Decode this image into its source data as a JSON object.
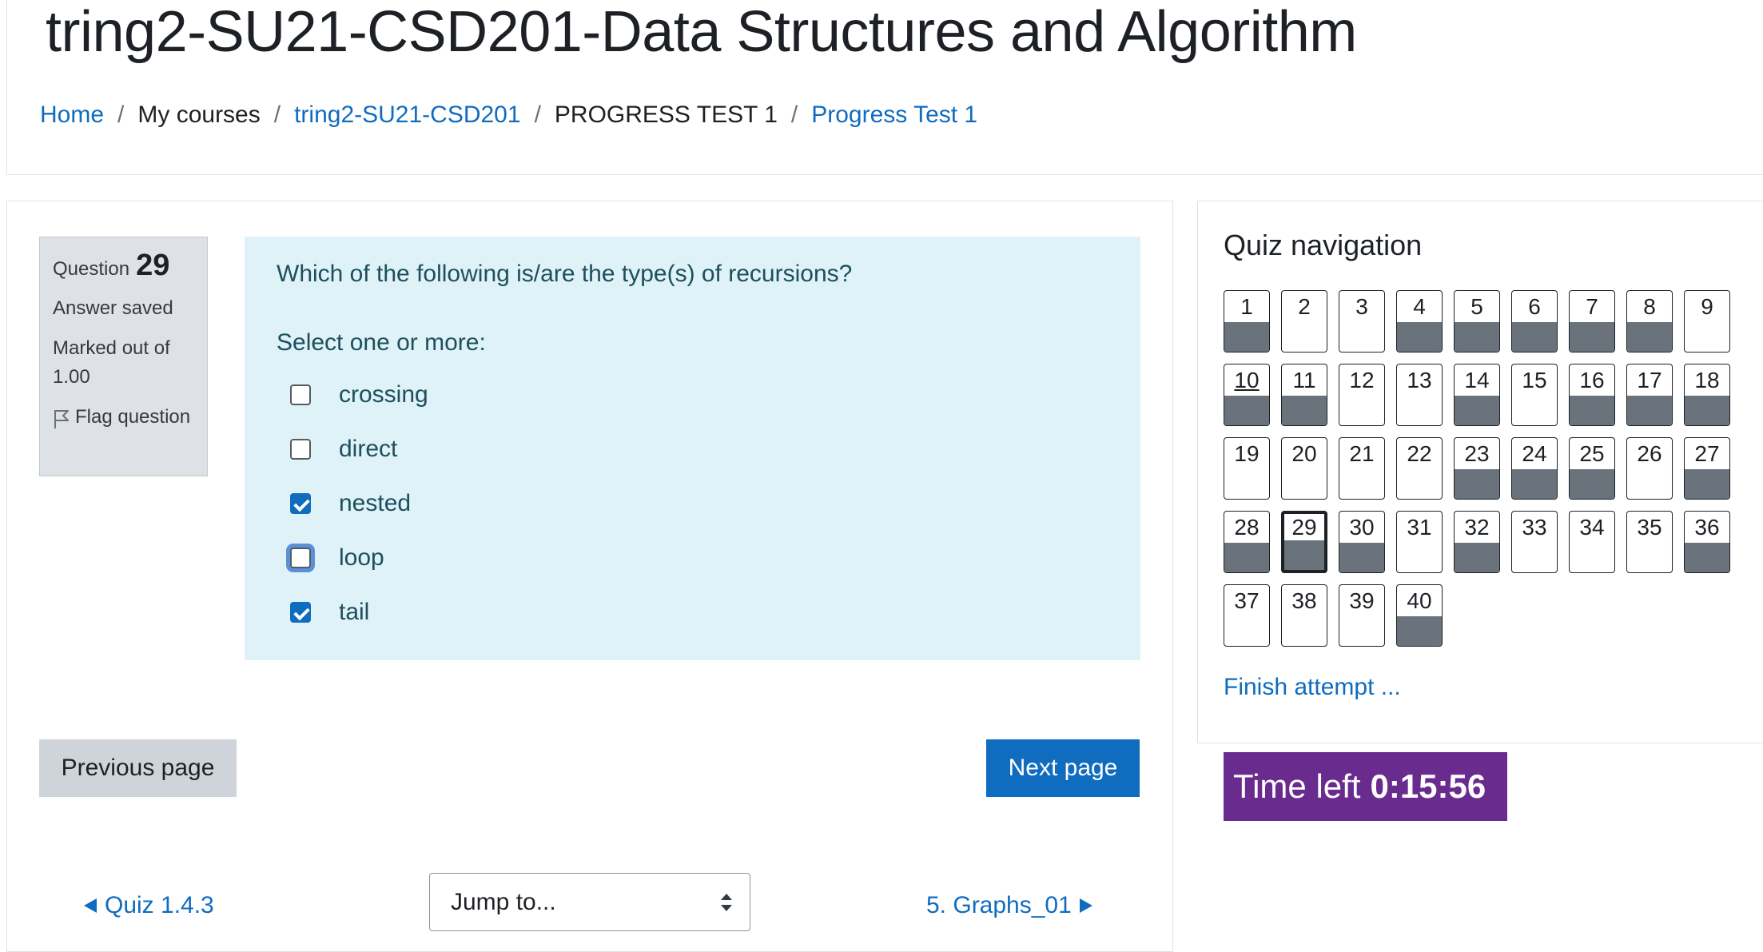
{
  "page_title": "tring2-SU21-CSD201-Data Structures and Algorithm",
  "breadcrumb": [
    {
      "label": "Home",
      "link": true
    },
    {
      "label": "My courses",
      "link": false
    },
    {
      "label": "tring2-SU21-CSD201",
      "link": true
    },
    {
      "label": "PROGRESS TEST 1",
      "link": false
    },
    {
      "label": "Progress Test 1",
      "link": true
    }
  ],
  "question_info": {
    "label": "Question",
    "number": "29",
    "state": "Answer saved",
    "grade": "Marked out of 1.00",
    "flag_label": "Flag question"
  },
  "question": {
    "text": "Which of the following is/are the type(s) of recursions?",
    "prompt": "Select one or more:",
    "options": [
      {
        "label": "crossing",
        "checked": false,
        "focused": false
      },
      {
        "label": "direct",
        "checked": false,
        "focused": false
      },
      {
        "label": "nested",
        "checked": true,
        "focused": false
      },
      {
        "label": "loop",
        "checked": false,
        "focused": true
      },
      {
        "label": "tail",
        "checked": true,
        "focused": false
      }
    ]
  },
  "buttons": {
    "previous": "Previous page",
    "next": "Next page"
  },
  "activity_nav": {
    "prev_label": "Quiz 1.4.3",
    "jump_label": "Jump to...",
    "next_label": "5. Graphs_01"
  },
  "quiz_nav": {
    "title": "Quiz navigation",
    "finish_label": "Finish attempt ...",
    "current": 29,
    "underlined": 10,
    "questions": [
      {
        "n": "1",
        "answered": true
      },
      {
        "n": "2",
        "answered": false
      },
      {
        "n": "3",
        "answered": false
      },
      {
        "n": "4",
        "answered": true
      },
      {
        "n": "5",
        "answered": true
      },
      {
        "n": "6",
        "answered": true
      },
      {
        "n": "7",
        "answered": true
      },
      {
        "n": "8",
        "answered": true
      },
      {
        "n": "9",
        "answered": false
      },
      {
        "n": "10",
        "answered": true
      },
      {
        "n": "11",
        "answered": true
      },
      {
        "n": "12",
        "answered": false
      },
      {
        "n": "13",
        "answered": false
      },
      {
        "n": "14",
        "answered": true
      },
      {
        "n": "15",
        "answered": false
      },
      {
        "n": "16",
        "answered": true
      },
      {
        "n": "17",
        "answered": true
      },
      {
        "n": "18",
        "answered": true
      },
      {
        "n": "19",
        "answered": false
      },
      {
        "n": "20",
        "answered": false
      },
      {
        "n": "21",
        "answered": false
      },
      {
        "n": "22",
        "answered": false
      },
      {
        "n": "23",
        "answered": true
      },
      {
        "n": "24",
        "answered": true
      },
      {
        "n": "25",
        "answered": true
      },
      {
        "n": "26",
        "answered": false
      },
      {
        "n": "27",
        "answered": true
      },
      {
        "n": "28",
        "answered": true
      },
      {
        "n": "29",
        "answered": true
      },
      {
        "n": "30",
        "answered": true
      },
      {
        "n": "31",
        "answered": false
      },
      {
        "n": "32",
        "answered": true
      },
      {
        "n": "33",
        "answered": false
      },
      {
        "n": "34",
        "answered": false
      },
      {
        "n": "35",
        "answered": false
      },
      {
        "n": "36",
        "answered": true
      },
      {
        "n": "37",
        "answered": false
      },
      {
        "n": "38",
        "answered": false
      },
      {
        "n": "39",
        "answered": false
      },
      {
        "n": "40",
        "answered": true
      }
    ]
  },
  "timer": {
    "label": "Time left",
    "value": "0:15:56"
  },
  "colors": {
    "link": "#0f6cbf",
    "question_bg": "#def2f8",
    "answered_fill": "#6a737b",
    "timer_bg": "#6a2b8e",
    "next_button": "#0f6cbf"
  },
  "icons": {
    "flag": "flag-outline-icon",
    "nav_prev": "triangle-left-icon",
    "nav_next": "triangle-right-icon",
    "select_arrows": "up-down-arrows-icon"
  }
}
